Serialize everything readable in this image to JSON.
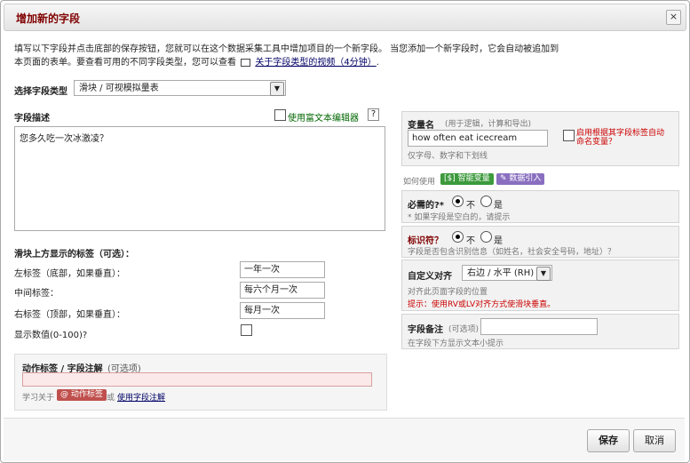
{
  "dialog": {
    "title": "增加新的字段",
    "close": "×"
  },
  "intro": {
    "line1": "填写以下字段并点击底部的保存按钮，您就可以在这个数据采集工具中增加项目的一个新字段。 当您添加一个新字段时，它会自动被追加到",
    "line2": "本页面的表单。要查看可用的不同字段类型，您可以查看",
    "link": "关于字段类型的视频（4分钟）",
    "period": "."
  },
  "field_type": {
    "label": "选择字段类型",
    "value": "滑块 / 可视模拟量表"
  },
  "description": {
    "label": "字段描述",
    "rich_text": "使用富文本编辑器",
    "help": "?",
    "value": "您多久吃一次冰激凌？"
  },
  "slider": {
    "heading": "滑块上方显示的标签（可选）：",
    "left_label": "左标签（底部，如果垂直）：",
    "left_value": "一年一次",
    "middle_label": "中间标签：",
    "middle_value": "每六个月一次",
    "right_label": "右标签（顶部，如果垂直）：",
    "right_value": "每月一次",
    "show_number": "显示数值(0-100)?"
  },
  "action_tags": {
    "label": "动作标签 / 字段注解",
    "optional": "(可选项)",
    "learn": "学习关于",
    "tag_button": "@ 动作标签",
    "or": "或",
    "link": "使用字段注解"
  },
  "variable": {
    "label": "变量名",
    "note": "(用于逻辑，计算和导出)",
    "value": "how often eat icecream",
    "hint": "仅字母、数字和下划线",
    "auto_label": "启用根据其字段标签自动命名变量？"
  },
  "how_to_use": {
    "label": "如何使用",
    "smart": "[$] 智能变量",
    "piping": "✎ 数据引入"
  },
  "required": {
    "label": "必需的?*",
    "no": "不",
    "yes": "是",
    "hint": "* 如果字段是空白的，请提示"
  },
  "identifier": {
    "label": "标识符？",
    "no": "不",
    "yes": "是",
    "hint": "字段是否包含识别信息（如姓名，社会安全号码，地址）？"
  },
  "align": {
    "label": "自定义对齐",
    "value": "右边 / 水平 (RH)",
    "hint": "对齐此页面字段的位置",
    "tip": "提示：使用RV或LV对齐方式使滑块垂直。"
  },
  "note": {
    "label": "字段备注",
    "optional": "(可选项)",
    "hint": "在字段下方显示文本小提示"
  },
  "footer": {
    "save": "保存",
    "cancel": "取消"
  },
  "colors": {
    "title": "#800000",
    "smart_badge": "#3c9a3c",
    "piping_badge": "#8a6fc0",
    "tag_button": "#c0504d"
  }
}
